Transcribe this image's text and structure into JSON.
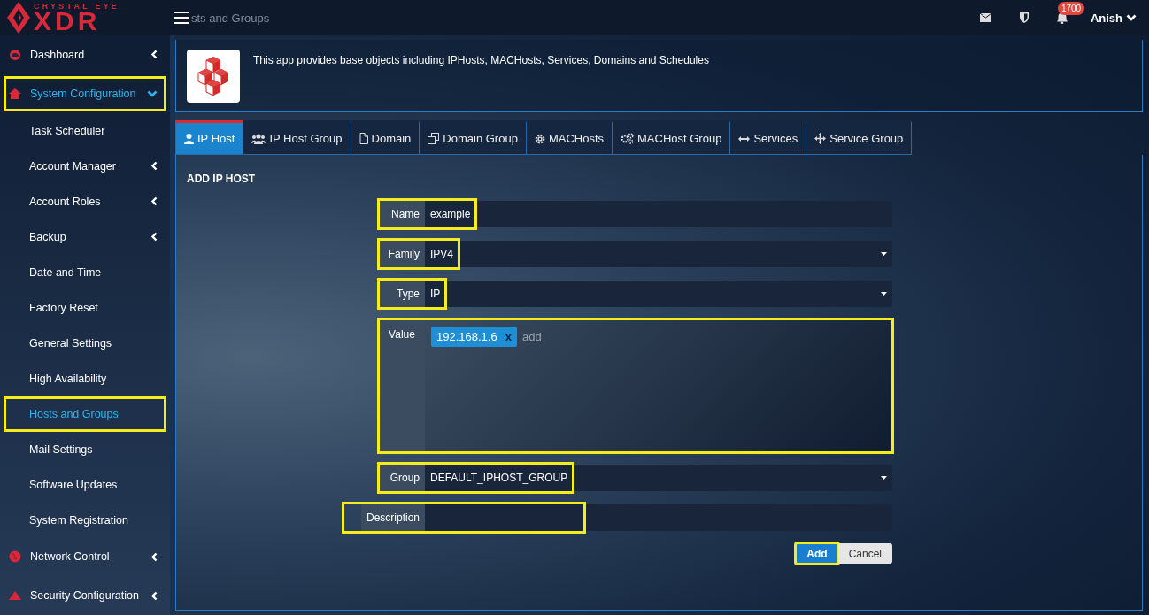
{
  "header": {
    "logo_top": "CRYSTAL EYE",
    "logo_main": "XDR",
    "page_title": "sts and Groups",
    "notification_count": "1700",
    "user": "Anish"
  },
  "sidebar": {
    "items": [
      {
        "label": "Dashboard",
        "expanded": false,
        "highlighted": false
      },
      {
        "label": "System Configuration",
        "expanded": true,
        "highlighted": true,
        "children": [
          {
            "label": "Task Scheduler",
            "has_submenu": false,
            "selected": false,
            "highlighted": false
          },
          {
            "label": "Account Manager",
            "has_submenu": true,
            "selected": false,
            "highlighted": false
          },
          {
            "label": "Account Roles",
            "has_submenu": true,
            "selected": false,
            "highlighted": false
          },
          {
            "label": "Backup",
            "has_submenu": true,
            "selected": false,
            "highlighted": false
          },
          {
            "label": "Date and Time",
            "has_submenu": false,
            "selected": false,
            "highlighted": false
          },
          {
            "label": "Factory Reset",
            "has_submenu": false,
            "selected": false,
            "highlighted": false
          },
          {
            "label": "General Settings",
            "has_submenu": false,
            "selected": false,
            "highlighted": false
          },
          {
            "label": "High Availability",
            "has_submenu": false,
            "selected": false,
            "highlighted": false
          },
          {
            "label": "Hosts and Groups",
            "has_submenu": false,
            "selected": true,
            "highlighted": true
          },
          {
            "label": "Mail Settings",
            "has_submenu": false,
            "selected": false,
            "highlighted": false
          },
          {
            "label": "Software Updates",
            "has_submenu": false,
            "selected": false,
            "highlighted": false
          },
          {
            "label": "System Registration",
            "has_submenu": false,
            "selected": false,
            "highlighted": false
          }
        ]
      },
      {
        "label": "Network Control",
        "expanded": false,
        "highlighted": false
      },
      {
        "label": "Security Configuration",
        "expanded": false,
        "highlighted": false
      }
    ]
  },
  "app_info": {
    "description": "This app provides base objects including IPHosts, MACHosts, Services, Domains and Schedules"
  },
  "tabs": [
    {
      "label": "IP Host",
      "selected": true
    },
    {
      "label": "IP Host Group",
      "selected": false
    },
    {
      "label": "Domain",
      "selected": false
    },
    {
      "label": "Domain Group",
      "selected": false
    },
    {
      "label": "MACHosts",
      "selected": false
    },
    {
      "label": "MACHost Group",
      "selected": false
    },
    {
      "label": "Services",
      "selected": false
    },
    {
      "label": "Service Group",
      "selected": false
    }
  ],
  "form": {
    "title": "ADD IP HOST",
    "fields": [
      {
        "kind": "text",
        "label": "Name",
        "value": "example",
        "highlighted": true
      },
      {
        "kind": "select",
        "label": "Family",
        "value": "IPV4",
        "highlighted": true
      },
      {
        "kind": "select",
        "label": "Type",
        "value": "IP",
        "highlighted": true
      },
      {
        "kind": "tags",
        "label": "Value",
        "tags": [
          {
            "text": "192.168.1.6",
            "remove": "x"
          }
        ],
        "placeholder": "add",
        "highlighted": true
      },
      {
        "kind": "select",
        "label": "Group",
        "value": "DEFAULT_IPHOST_GROUP",
        "highlighted": true
      },
      {
        "kind": "text",
        "label": "Description",
        "highlighted": true
      }
    ],
    "buttons": [
      {
        "label": "Add",
        "kind": "primary",
        "highlighted": true
      },
      {
        "label": "Cancel",
        "kind": "secondary",
        "highlighted": false
      }
    ]
  }
}
